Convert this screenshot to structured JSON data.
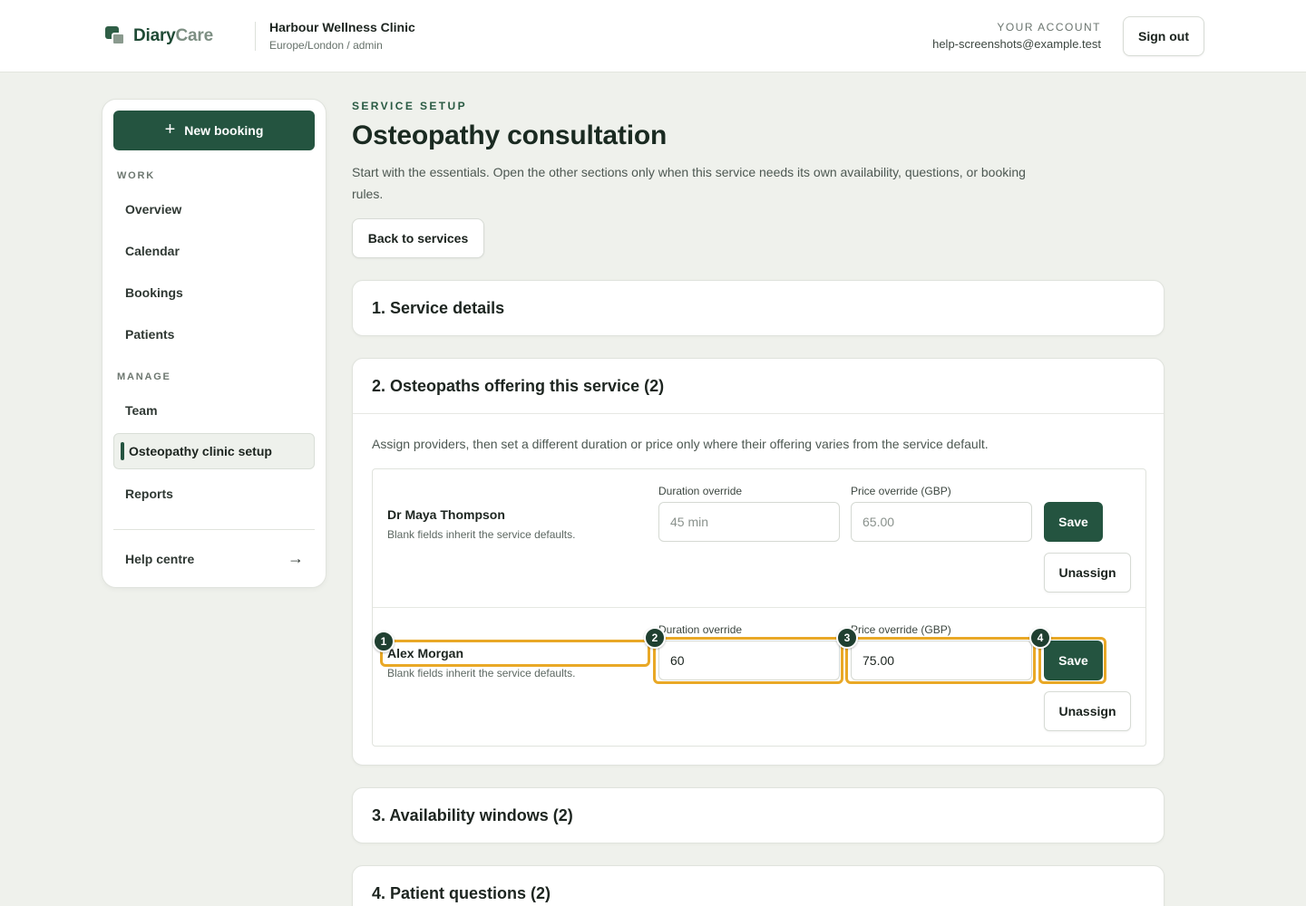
{
  "header": {
    "brand_a": "Diary",
    "brand_b": "Care",
    "clinic_name": "Harbour Wellness Clinic",
    "clinic_sub": "Europe/London / admin",
    "account_label": "YOUR ACCOUNT",
    "account_email": "help-screenshots@example.test",
    "signout_label": "Sign out"
  },
  "sidebar": {
    "new_booking_label": "New booking",
    "sections": {
      "work": "WORK",
      "manage": "MANAGE"
    },
    "work_items": [
      "Overview",
      "Calendar",
      "Bookings",
      "Patients"
    ],
    "manage_items": [
      "Team",
      "Osteopathy clinic setup",
      "Reports"
    ],
    "active_item": "Osteopathy clinic setup",
    "help_label": "Help centre",
    "help_arrow": "→"
  },
  "main": {
    "eyebrow": "SERVICE SETUP",
    "title": "Osteopathy consultation",
    "description": "Start with the essentials. Open the other sections only when this service needs its own availability, questions, or booking rules.",
    "back_label": "Back to services",
    "sections": [
      "1. Service details",
      "2. Osteopaths offering this service (2)",
      "3. Availability windows (2)",
      "4. Patient questions (2)"
    ],
    "providers_desc": "Assign providers, then set a different duration or price only where their offering varies from the service default.",
    "providers": [
      {
        "name": "Dr Maya Thompson",
        "hint": "Blank fields inherit the service defaults.",
        "duration_label": "Duration override",
        "duration_value": "",
        "duration_placeholder": "45 min",
        "price_label": "Price override (GBP)",
        "price_value": "",
        "price_placeholder": "65.00",
        "save_label": "Save",
        "unassign_label": "Unassign"
      },
      {
        "name": "Alex Morgan",
        "hint": "Blank fields inherit the service defaults.",
        "duration_label": "Duration override",
        "duration_value": "60",
        "price_label": "Price override (GBP)",
        "price_value": "75.00",
        "save_label": "Save",
        "unassign_label": "Unassign"
      }
    ]
  },
  "annotations": [
    "1",
    "2",
    "3",
    "4"
  ],
  "colors": {
    "brand_primary": "#245440",
    "highlight": "#e9a826",
    "badge": "#1f3f30",
    "page_bg": "#eff1ec"
  }
}
